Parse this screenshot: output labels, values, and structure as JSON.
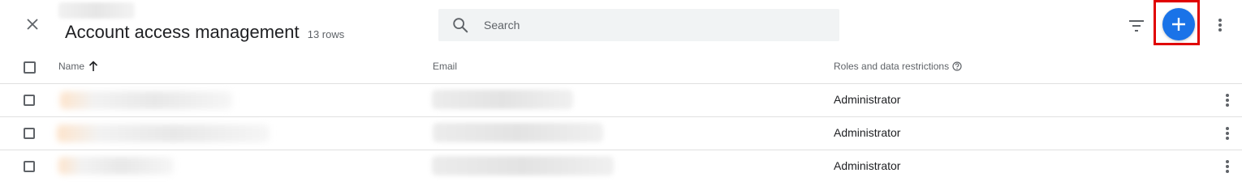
{
  "header": {
    "title": "Account access management",
    "row_count": "13 rows",
    "search": {
      "placeholder": "Search",
      "value": ""
    }
  },
  "table": {
    "columns": {
      "name": "Name",
      "email": "Email",
      "roles": "Roles and data restrictions"
    },
    "rows": [
      {
        "role": "Administrator"
      },
      {
        "role": "Administrator"
      },
      {
        "role": "Administrator"
      }
    ]
  },
  "colors": {
    "accent": "#1a73e8",
    "highlight": "#e00000",
    "icon": "#5f6368"
  },
  "icons": {
    "close": "close-icon",
    "search": "search-icon",
    "filter": "filter-icon",
    "add": "plus-icon",
    "more": "more-vert-icon",
    "sort": "arrow-up-icon",
    "help": "help-circle-icon"
  }
}
